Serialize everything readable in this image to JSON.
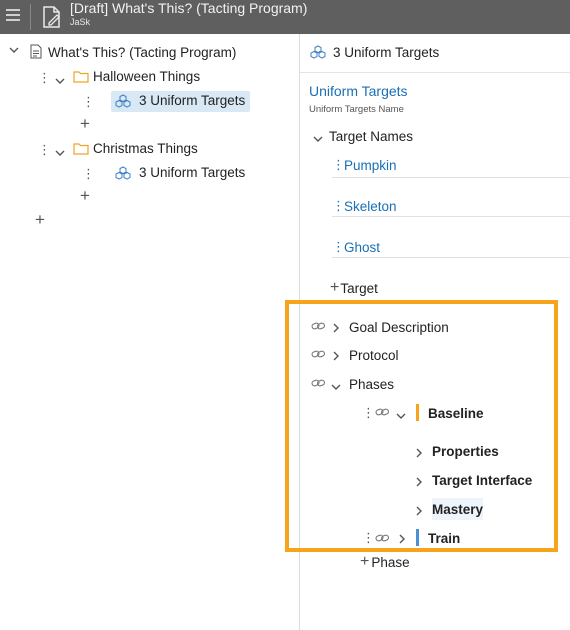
{
  "app": {
    "title": "[Draft] What's This? (Tacting Program)",
    "subtitle": "JaSk"
  },
  "tree": {
    "root_label": "What's This? (Tacting Program)",
    "folders": [
      {
        "label": "Halloween Things",
        "item": "3 Uniform Targets"
      },
      {
        "label": "Christmas Things",
        "item": "3 Uniform Targets"
      }
    ]
  },
  "detail": {
    "header_title": "3 Uniform Targets",
    "name_value": "Uniform Targets",
    "name_caption": "Uniform Targets Name",
    "target_names_label": "Target Names",
    "targets": [
      "Pumpkin",
      "Skeleton",
      "Ghost"
    ],
    "add_target_label": "Target",
    "sections": [
      "Goal Description",
      "Protocol",
      "Phases"
    ],
    "phases": [
      {
        "label": "Baseline",
        "color": "#f5a41b",
        "children": [
          "Properties",
          "Target Interface",
          "Mastery"
        ]
      },
      {
        "label": "Train",
        "color": "#4a90d9"
      }
    ],
    "add_phase_label": "Phase"
  },
  "colors": {
    "highlight": "#f5a41b",
    "link": "#1a6fb5",
    "titlebar": "#5f5f5f"
  }
}
